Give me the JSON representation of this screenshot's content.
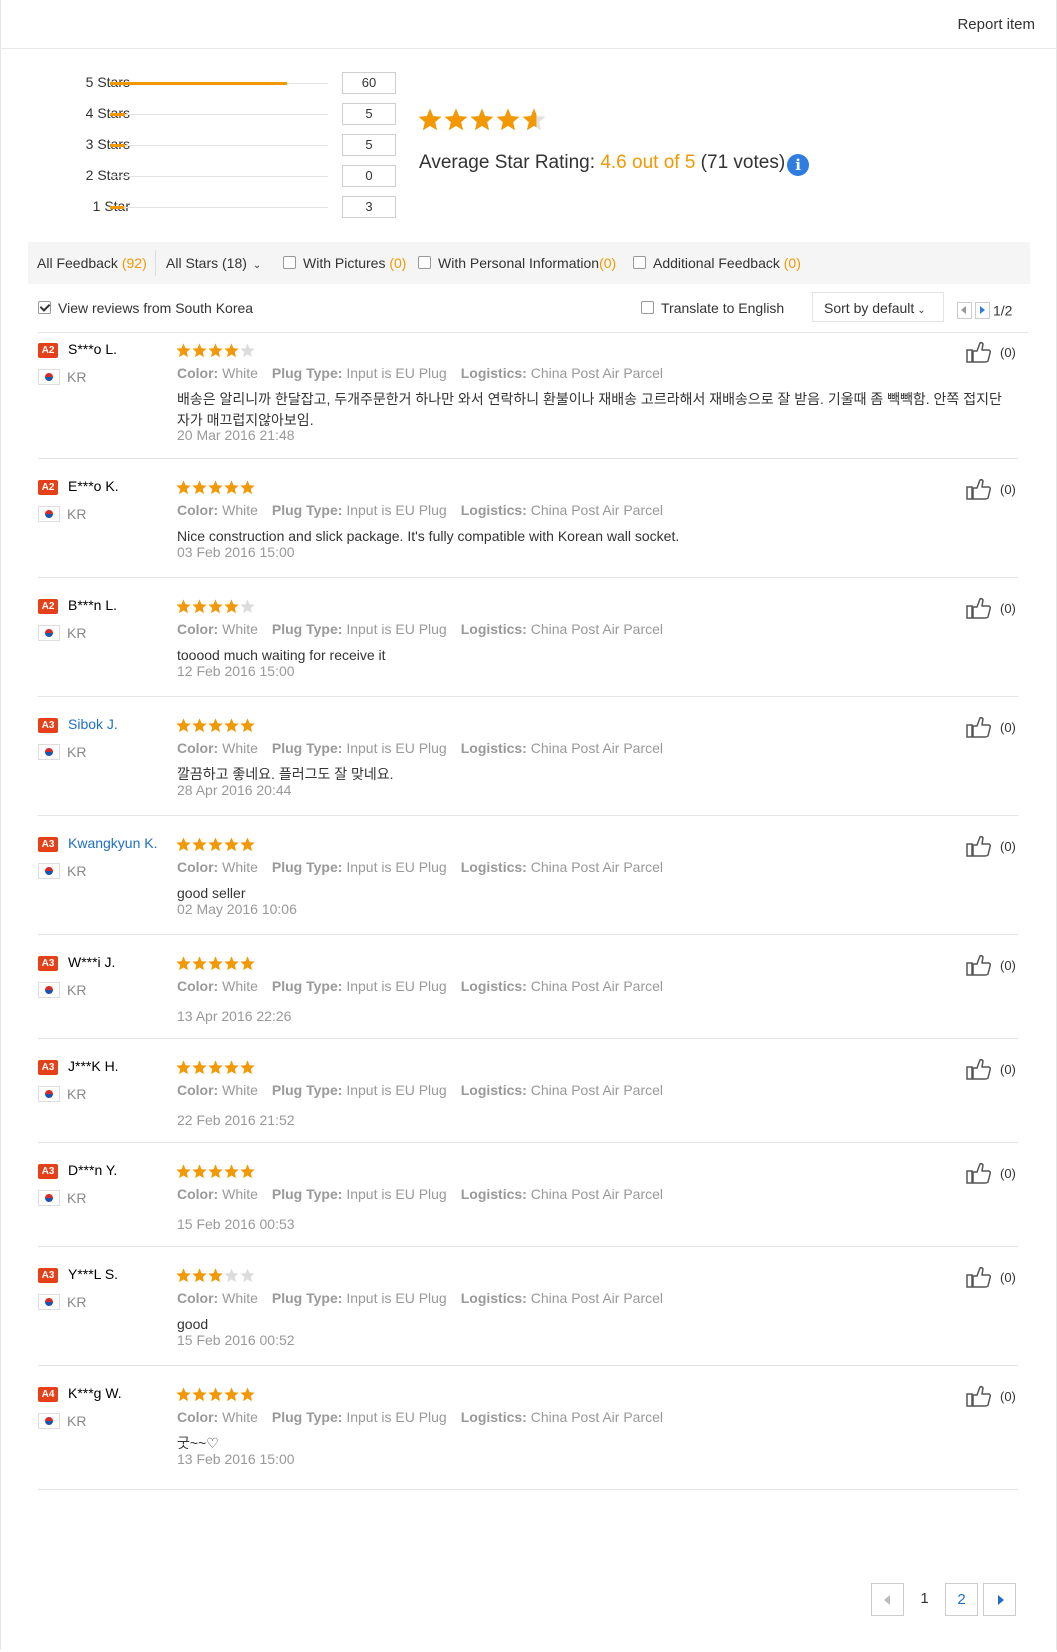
{
  "header": {
    "report_label": "Report item"
  },
  "rating_summary": {
    "rows": [
      {
        "label": "5 Stars",
        "count": "60",
        "fraction": 0.8451
      },
      {
        "label": "4 Stars",
        "count": "5",
        "fraction": 0.0704
      },
      {
        "label": "3 Stars",
        "count": "5",
        "fraction": 0.0704
      },
      {
        "label": "2 Stars",
        "count": "0",
        "fraction": 0
      },
      {
        "label": "1 Star",
        "count": "3",
        "fraction": 0.0423
      }
    ],
    "average_prefix": "Average Star Rating:",
    "average_value": "4.6 out of 5",
    "votes": "(71 votes)",
    "average_stars": 4.6,
    "info_glyph": "i"
  },
  "filters": {
    "all_feedback": "All Feedback",
    "all_feedback_count": "(92)",
    "all_stars": "All Stars (18)",
    "with_pictures": "With Pictures",
    "with_pictures_count": "(0)",
    "with_personal": "With Personal Information",
    "with_personal_count": "(0)",
    "additional": "Additional Feedback",
    "additional_count": "(0)"
  },
  "view_bar": {
    "view_reviews": "View reviews from South Korea",
    "translate": "Translate to English",
    "sort": "Sort by default",
    "page_indicator": "1/2"
  },
  "reviews": [
    {
      "level": "A2",
      "name": "S***o L.",
      "link": false,
      "country": "KR",
      "stars": 4,
      "color_label": "Color:",
      "color": "White",
      "plug_label": "Plug Type:",
      "plug": "Input is EU Plug",
      "logistics_label": "Logistics:",
      "logistics": "China Post Air Parcel",
      "content": "배송은 알리니까 한달잡고, 두개주문한거 하나만 와서 연락하니 환불이나 재배송 고르라해서 재배송으로 잘 받음. 기울때 좀 빽빽함. 안쪽 접지단자가 매끄럽지않아보임.",
      "date": "20 Mar 2016 21:48",
      "helpful": "(0)"
    },
    {
      "level": "A2",
      "name": "E***o K.",
      "link": false,
      "country": "KR",
      "stars": 5,
      "color_label": "Color:",
      "color": "White",
      "plug_label": "Plug Type:",
      "plug": "Input is EU Plug",
      "logistics_label": "Logistics:",
      "logistics": "China Post Air Parcel",
      "content": "Nice construction and slick package. It's fully compatible with Korean wall socket.",
      "date": "03 Feb 2016 15:00",
      "helpful": "(0)"
    },
    {
      "level": "A2",
      "name": "B***n L.",
      "link": false,
      "country": "KR",
      "stars": 4,
      "color_label": "Color:",
      "color": "White",
      "plug_label": "Plug Type:",
      "plug": "Input is EU Plug",
      "logistics_label": "Logistics:",
      "logistics": "China Post Air Parcel",
      "content": "tooood much waiting for receive it",
      "date": "12 Feb 2016 15:00",
      "helpful": "(0)"
    },
    {
      "level": "A3",
      "name": "Sibok J.",
      "link": true,
      "country": "KR",
      "stars": 5,
      "color_label": "Color:",
      "color": "White",
      "plug_label": "Plug Type:",
      "plug": "Input is EU Plug",
      "logistics_label": "Logistics:",
      "logistics": "China Post Air Parcel",
      "content": "깔끔하고 좋네요. 플러그도 잘 맞네요.",
      "date": "28 Apr 2016 20:44",
      "helpful": "(0)"
    },
    {
      "level": "A3",
      "name": "Kwangkyun K.",
      "link": true,
      "country": "KR",
      "stars": 5,
      "color_label": "Color:",
      "color": "White",
      "plug_label": "Plug Type:",
      "plug": "Input is EU Plug",
      "logistics_label": "Logistics:",
      "logistics": "China Post Air Parcel",
      "content": "good seller",
      "date": "02 May 2016 10:06",
      "helpful": "(0)"
    },
    {
      "level": "A3",
      "name": "W***i J.",
      "link": false,
      "country": "KR",
      "stars": 5,
      "color_label": "Color:",
      "color": "White",
      "plug_label": "Plug Type:",
      "plug": "Input is EU Plug",
      "logistics_label": "Logistics:",
      "logistics": "China Post Air Parcel",
      "content": "",
      "date": "13 Apr 2016 22:26",
      "helpful": "(0)"
    },
    {
      "level": "A3",
      "name": "J***K H.",
      "link": false,
      "country": "KR",
      "stars": 5,
      "color_label": "Color:",
      "color": "White",
      "plug_label": "Plug Type:",
      "plug": "Input is EU Plug",
      "logistics_label": "Logistics:",
      "logistics": "China Post Air Parcel",
      "content": "",
      "date": "22 Feb 2016 21:52",
      "helpful": "(0)"
    },
    {
      "level": "A3",
      "name": "D***n Y.",
      "link": false,
      "country": "KR",
      "stars": 5,
      "color_label": "Color:",
      "color": "White",
      "plug_label": "Plug Type:",
      "plug": "Input is EU Plug",
      "logistics_label": "Logistics:",
      "logistics": "China Post Air Parcel",
      "content": "",
      "date": "15 Feb 2016 00:53",
      "helpful": "(0)"
    },
    {
      "level": "A3",
      "name": "Y***L S.",
      "link": false,
      "country": "KR",
      "stars": 3,
      "color_label": "Color:",
      "color": "White",
      "plug_label": "Plug Type:",
      "plug": "Input is EU Plug",
      "logistics_label": "Logistics:",
      "logistics": "China Post Air Parcel",
      "content": "good",
      "date": "15 Feb 2016 00:52",
      "helpful": "(0)"
    },
    {
      "level": "A4",
      "name": "K***g W.",
      "link": false,
      "country": "KR",
      "stars": 5,
      "color_label": "Color:",
      "color": "White",
      "plug_label": "Plug Type:",
      "plug": "Input is EU Plug",
      "logistics_label": "Logistics:",
      "logistics": "China Post Air Parcel",
      "content": "굿~~♡",
      "date": "13 Feb 2016 15:00",
      "helpful": "(0)"
    }
  ],
  "pagination": {
    "pages": [
      "1",
      "2"
    ],
    "current": "2"
  },
  "colors": {
    "accent": "#f39800",
    "link": "#1f6fc6",
    "badge": "#e64019",
    "info": "#2f7de1"
  },
  "icons": {
    "thumb": "thumbs-up-icon",
    "info": "info-icon",
    "flag": "korea-flag-icon",
    "star": "star-icon"
  }
}
